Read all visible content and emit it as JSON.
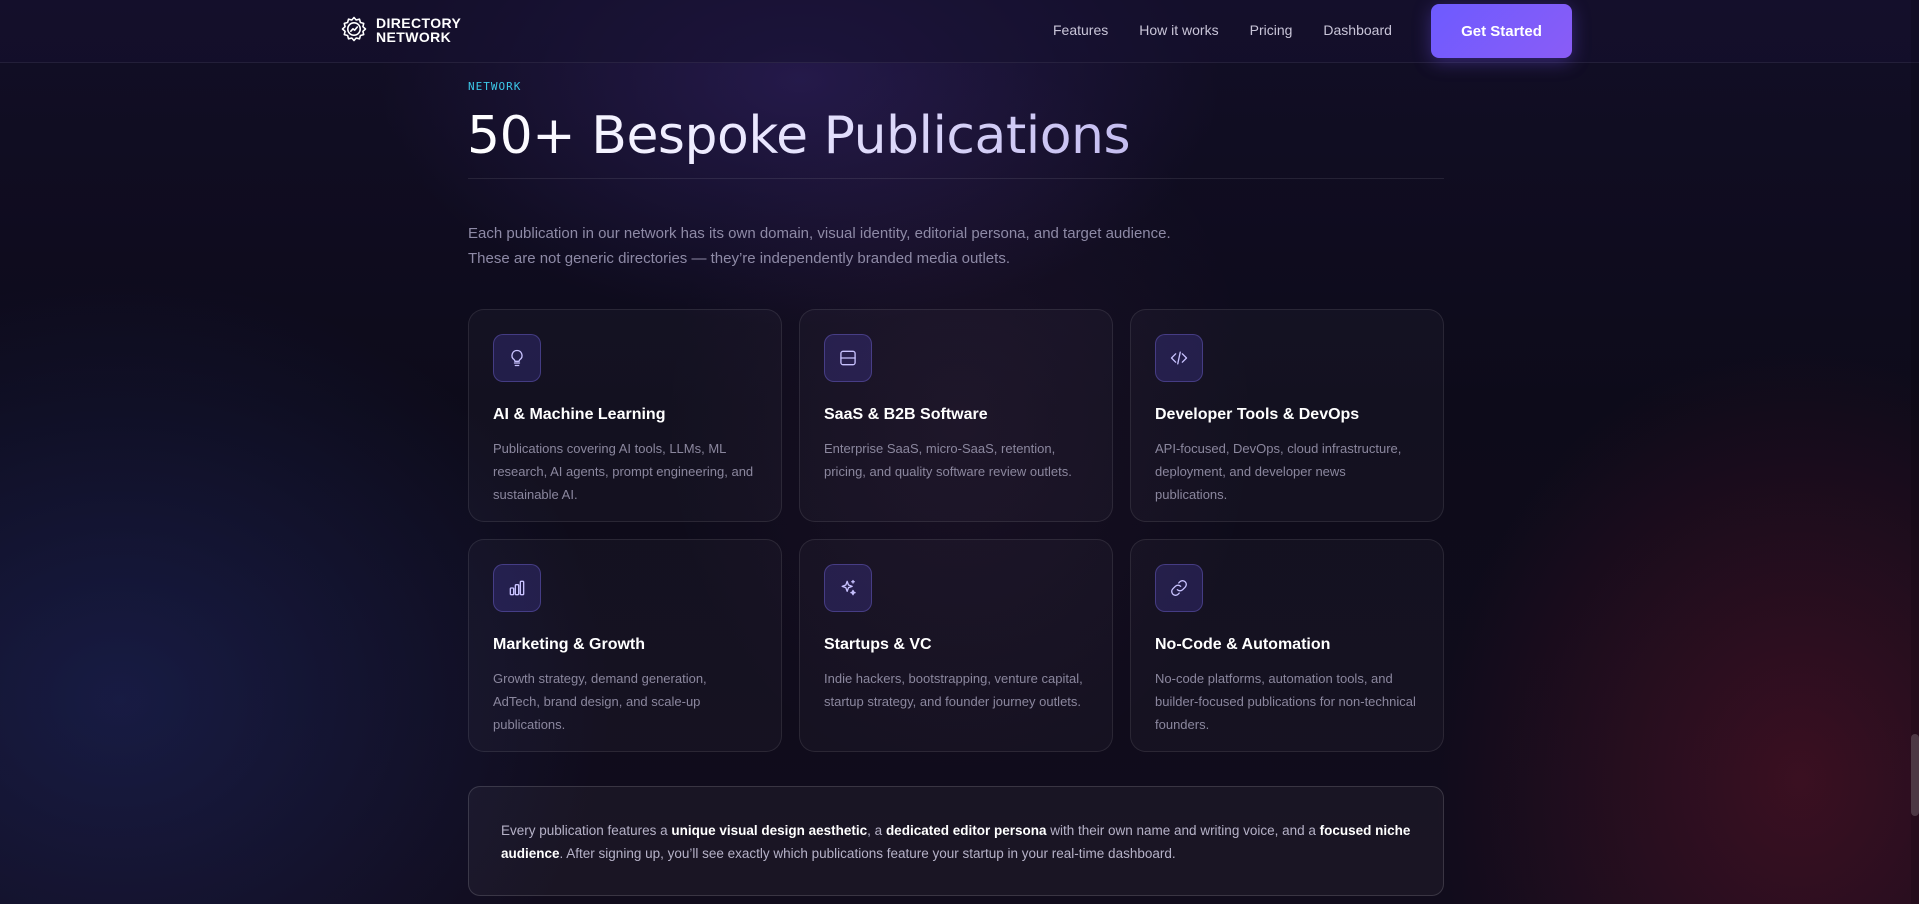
{
  "header": {
    "brand_line1": "DIRECTORY",
    "brand_line2": "NETWORK",
    "nav": [
      {
        "label": "Features"
      },
      {
        "label": "How it works"
      },
      {
        "label": "Pricing"
      },
      {
        "label": "Dashboard"
      }
    ],
    "cta_label": "Get Started"
  },
  "section": {
    "eyebrow": "NETWORK",
    "title": "50+ Bespoke Publications",
    "intro_line1": "Each publication in our network has its own domain, visual identity, editorial persona, and target audience.",
    "intro_line2": "These are not generic directories — they’re independently branded media outlets."
  },
  "cards": [
    {
      "icon": "lightbulb-icon",
      "title": "AI & Machine Learning",
      "desc": "Publications covering AI tools, LLMs, ML research, AI agents, prompt engineering, and sustainable AI."
    },
    {
      "icon": "server-icon",
      "title": "SaaS & B2B Software",
      "desc": "Enterprise SaaS, micro-SaaS, retention, pricing, and quality software review outlets."
    },
    {
      "icon": "code-icon",
      "title": "Developer Tools & DevOps",
      "desc": "API-focused, DevOps, cloud infrastructure, deployment, and developer news publications."
    },
    {
      "icon": "bar-chart-icon",
      "title": "Marketing & Growth",
      "desc": "Growth strategy, demand generation, AdTech, brand design, and scale-up publications."
    },
    {
      "icon": "sparkles-icon",
      "title": "Startups & VC",
      "desc": "Indie hackers, bootstrapping, venture capital, startup strategy, and founder journey outlets."
    },
    {
      "icon": "link-icon",
      "title": "No-Code & Automation",
      "desc": "No-code platforms, automation tools, and builder-focused publications for non-technical founders."
    }
  ],
  "callout": {
    "t1": "Every publication features a ",
    "b1": "unique visual design aesthetic",
    "t2": ", a ",
    "b2": "dedicated editor persona",
    "t3": " with their own name and writing voice, and a ",
    "b3": "focused niche audience",
    "t4": ". After signing up, you’ll see exactly which publications feature your startup in your real-time dashboard."
  },
  "colors": {
    "accent": "#6d5bff",
    "accent_secondary": "#8a5cf6",
    "eyebrow": "#3cc8e8",
    "background": "#0d0b1a"
  }
}
